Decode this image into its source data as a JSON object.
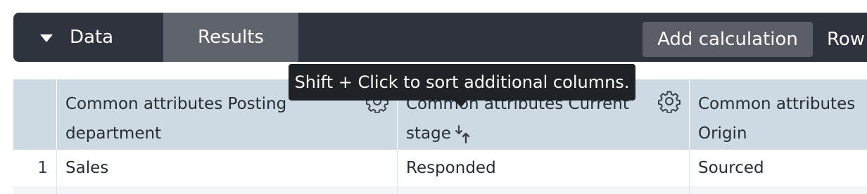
{
  "toolbar": {
    "tabs": [
      {
        "label": "Data"
      },
      {
        "label": "Results"
      }
    ],
    "add_calculation_label": "Add calculation",
    "row_label": "Row"
  },
  "tooltip": {
    "text": "Shift + Click to sort additional columns."
  },
  "table": {
    "columns": [
      {
        "label": "Common attributes Posting department",
        "line1": "Common attributes Posting",
        "line2": "department"
      },
      {
        "label": "Common attributes Current stage",
        "line1": "Common attributes Current",
        "line2": "stage"
      },
      {
        "label": "Common attributes Origin",
        "line1": "Common attributes",
        "line2": "Origin"
      }
    ],
    "rows": [
      {
        "index": "1",
        "cells": [
          "Sales",
          "Responded",
          "Sourced"
        ]
      }
    ]
  },
  "colors": {
    "toolbar_bg": "#2f333d",
    "active_tab_bg": "#5f636b",
    "header_bg": "#cdd9e3",
    "tooltip_bg": "#1f2226"
  },
  "icons": [
    "caret-down-icon",
    "gear-icon",
    "sort-arrows-icon"
  ]
}
